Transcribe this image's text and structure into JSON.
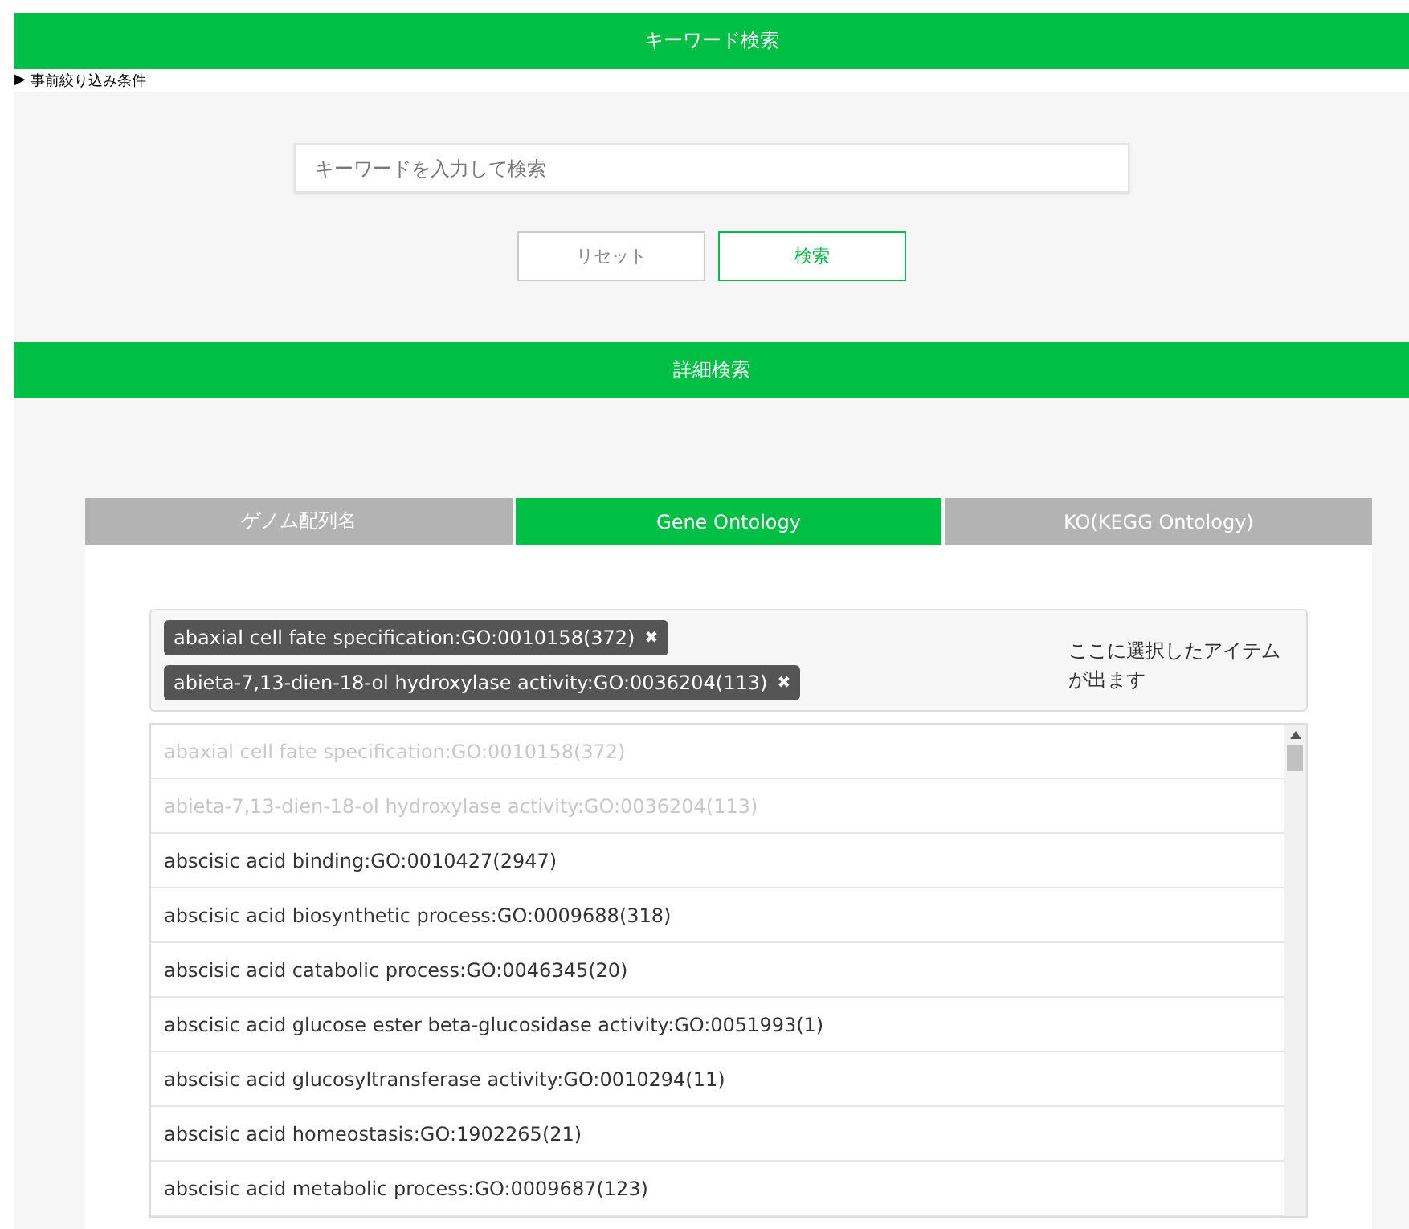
{
  "keyword_search": {
    "title": "キーワード検索",
    "prefilter": {
      "icon": "▶",
      "label": "事前絞り込み条件"
    },
    "search": {
      "placeholder": "キーワードを入力して検索"
    },
    "buttons": [
      {
        "label": "リセット",
        "kind": "reset"
      },
      {
        "label": "検索",
        "kind": "submit"
      }
    ]
  },
  "detail_search": {
    "title": "詳細検索",
    "tabs": [
      {
        "label": "ゲノム配列名",
        "selected": false
      },
      {
        "label": "Gene Ontology",
        "selected": true
      },
      {
        "label": "KO(KEGG Ontology)",
        "selected": false
      }
    ],
    "selected_items": [
      {
        "label": "abaxial cell fate specification:GO:0010158(372)",
        "remove": "✖"
      },
      {
        "label": "abieta-7,13-dien-18-ol hydroxylase activity:GO:0036204(113)",
        "remove": "✖"
      }
    ],
    "selection_hint": "ここに選択したアイテムが出ます",
    "options": [
      {
        "label": "abaxial cell fate specification:GO:0010158(372)",
        "disabled": true
      },
      {
        "label": "abieta-7,13-dien-18-ol hydroxylase activity:GO:0036204(113)",
        "disabled": true
      },
      {
        "label": "abscisic acid binding:GO:0010427(2947)",
        "disabled": false
      },
      {
        "label": "abscisic acid biosynthetic process:GO:0009688(318)",
        "disabled": false
      },
      {
        "label": "abscisic acid catabolic process:GO:0046345(20)",
        "disabled": false
      },
      {
        "label": "abscisic acid glucose ester beta-glucosidase activity:GO:0051993(1)",
        "disabled": false
      },
      {
        "label": "abscisic acid glucosyltransferase activity:GO:0010294(11)",
        "disabled": false
      },
      {
        "label": "abscisic acid homeostasis:GO:1902265(21)",
        "disabled": false
      },
      {
        "label": "abscisic acid metabolic process:GO:0009687(123)",
        "disabled": false
      }
    ]
  }
}
